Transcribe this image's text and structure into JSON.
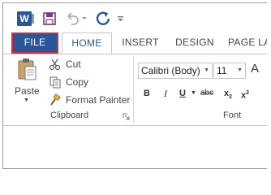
{
  "qat": {
    "app_logo": "W",
    "icons": [
      "word-logo-icon",
      "save-icon",
      "undo-icon",
      "redo-icon",
      "customize-icon"
    ]
  },
  "tabs": [
    {
      "label": "FILE"
    },
    {
      "label": "HOME"
    },
    {
      "label": "INSERT"
    },
    {
      "label": "DESIGN"
    },
    {
      "label": "PAGE LA"
    }
  ],
  "clipboard": {
    "paste": "Paste",
    "cut": "Cut",
    "copy": "Copy",
    "format_painter": "Format Painter",
    "group_label": "Clipboard"
  },
  "font": {
    "font_name": "Calibri (Body)",
    "font_size": "11",
    "bold": "B",
    "italic": "I",
    "underline": "U",
    "strikethrough": "abc",
    "subscript": "x",
    "superscript": "x",
    "subscript_mark": "2",
    "superscript_mark": "2",
    "grow": "A",
    "group_label": "Font"
  },
  "colors": {
    "brand": "#2b579a",
    "highlight_box": "#d52b3d"
  }
}
